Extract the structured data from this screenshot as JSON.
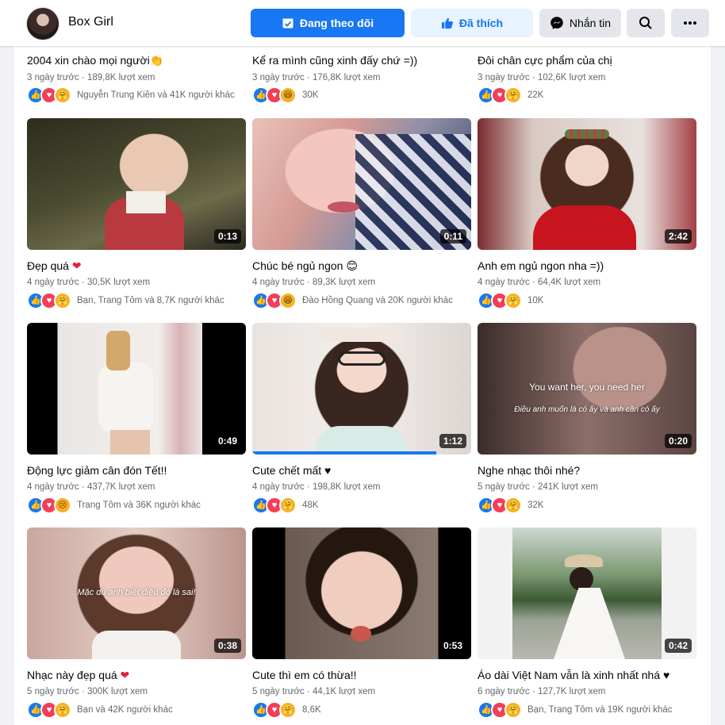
{
  "header": {
    "page_name": "Box Girl",
    "follow_label": "Đang theo dõi",
    "like_label": "Đã thích",
    "message_label": "Nhắn tin",
    "accent": "#1877f2"
  },
  "videos": [
    {
      "title": "2004 xin chào mọi người👏",
      "meta": "3 ngày trước · 189,8K lượt xem",
      "reactions": [
        "like",
        "love",
        "care"
      ],
      "react_text": "Nguyễn Trung Kiên và 41K người khác"
    },
    {
      "title": "Kể ra mình cũng xinh đấy chứ =))",
      "meta": "3 ngày trước · 176,8K lượt xem",
      "reactions": [
        "like",
        "love",
        "haha"
      ],
      "react_text": "30K"
    },
    {
      "title": "Đôi chân cực phẩm của chị",
      "meta": "3 ngày trước · 102,6K lượt xem",
      "reactions": [
        "like",
        "love",
        "care"
      ],
      "react_text": "22K"
    },
    {
      "title": "Đẹp quá ",
      "heart": "❤",
      "meta": "4 ngày trước · 30,5K lượt xem",
      "reactions": [
        "like",
        "love",
        "care"
      ],
      "react_text": "Bạn, Trang Tôm và 8,7K người khác",
      "duration": "0:13"
    },
    {
      "title": "Chúc bé ngủ ngon 😊",
      "meta": "4 ngày trước · 89,3K lượt xem",
      "reactions": [
        "like",
        "love",
        "haha"
      ],
      "react_text": "Đào Hồng Quang và 20K người khác",
      "duration": "0:11"
    },
    {
      "title": "Anh em ngủ ngon nha =))",
      "meta": "4 ngày trước · 64,4K lượt xem",
      "reactions": [
        "like",
        "love",
        "care"
      ],
      "react_text": "10K",
      "duration": "2:42"
    },
    {
      "title": "Động lực giảm cân đón Tết!!",
      "meta": "4 ngày trước · 437,7K lượt xem",
      "reactions": [
        "like",
        "love",
        "sad"
      ],
      "react_text": "Trang Tôm và 36K người khác",
      "duration": "0:49"
    },
    {
      "title": "Cute chết mất ♥",
      "meta": "4 ngày trước · 198,8K lượt xem",
      "reactions": [
        "like",
        "love",
        "care"
      ],
      "react_text": "48K",
      "duration": "1:12",
      "progress": 0.84
    },
    {
      "title": "Nghe nhạc thôi nhé?",
      "meta": "5 ngày trước · 241K lượt xem",
      "reactions": [
        "like",
        "love",
        "care"
      ],
      "react_text": "32K",
      "duration": "0:20",
      "overlay1": "You want her, you need her",
      "overlay2": "Điều anh muốn là có ấy và anh cần có ấy"
    },
    {
      "title": "Nhạc này đẹp quá ",
      "heart": "❤",
      "meta": "5 ngày trước · 300K lượt xem",
      "reactions": [
        "like",
        "love",
        "care"
      ],
      "react_text": "Bạn và 42K người khác",
      "duration": "0:38",
      "overlay1": "Mặc dù anh biết điều đó là sai!"
    },
    {
      "title": "Cute thì em có thừa!!",
      "meta": "5 ngày trước · 44,1K lượt xem",
      "reactions": [
        "like",
        "love",
        "care"
      ],
      "react_text": "8,6K",
      "duration": "0:53"
    },
    {
      "title": "Áo dài Việt Nam vẫn là xinh nhất nhá ♥",
      "meta": "6 ngày trước · 127,7K lượt xem",
      "reactions": [
        "like",
        "love",
        "care"
      ],
      "react_text": "Bạn, Trang Tôm và 19K người khác",
      "duration": "0:42"
    }
  ],
  "reaction_icons": {
    "like": "thumbs-up-icon",
    "love": "heart-icon",
    "care": "care-face-icon",
    "haha": "haha-face-icon",
    "sad": "sad-face-icon"
  }
}
